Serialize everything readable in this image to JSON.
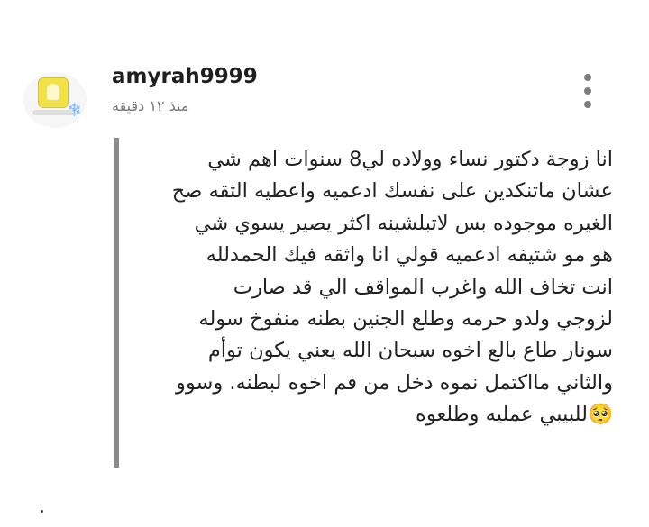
{
  "comment": {
    "username": "amyrah9999",
    "time": "منذ ١٢ دقيقة",
    "menu_icon": "more-vertical-icon",
    "avatar_icon": "avatar-snap-icon",
    "lines": [
      "انا زوجة دكتور نساء وولاده لي8 سنوات اهم شي",
      "عشان ماتنكدين على نفسك ادعميه واعطيه الثقه صح",
      "الغيره موجوده بس لاتبلشينه اكثر يصير يسوي شي",
      "هو مو شتيفه ادعميه قولي انا واثقه فيك الحمدلله",
      "انت تخاف الله  واغرب المواقف الي قد صارت",
      "لزوجي ولدو حرمه وطلع الجنين بطنه منفوخ سوله",
      "سونار طاع بالع اخوه سبحان الله يعني يكون توأم",
      "والثاني مااكتمل نموه دخل من فم اخوه لبطنه. وسوو",
      "🥺للبيبي عمليه وطلعوه"
    ]
  },
  "colors": {
    "background": "#ffffff",
    "text": "#222222",
    "muted": "#7a7a7a",
    "quote_bar": "#8a8a8a"
  }
}
